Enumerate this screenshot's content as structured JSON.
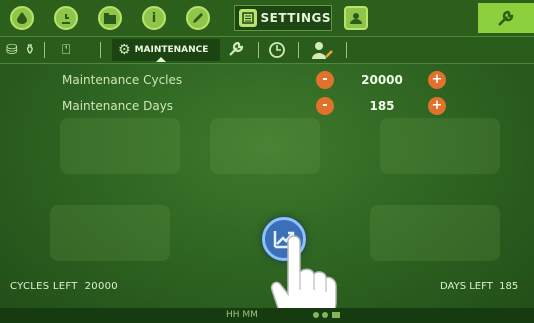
{
  "topbar": {
    "icons": [
      "water-drop-icon",
      "clock-icon",
      "folder-icon",
      "info-icon",
      "pencil-icon",
      "settings-icon",
      "user-icon",
      "wrench-icon"
    ],
    "settings_label": "SETTINGS",
    "accent_color": "#8cd13d"
  },
  "subbar": {
    "maintenance_label": "MAINTENANCE"
  },
  "params": {
    "cycles": {
      "label": "Maintenance Cycles",
      "value": "20000"
    },
    "days": {
      "label": "Maintenance Days",
      "value": "185"
    }
  },
  "footer": {
    "cycles_left_label": "CYCLES LEFT",
    "cycles_left_value": "20000",
    "days_left_label": "DAYS LEFT",
    "days_left_value": "185",
    "time_label": "HH MM"
  },
  "colors": {
    "background": "#2f6622",
    "stepper_button": "#e0722d",
    "center_button": "#3b6fb8"
  }
}
